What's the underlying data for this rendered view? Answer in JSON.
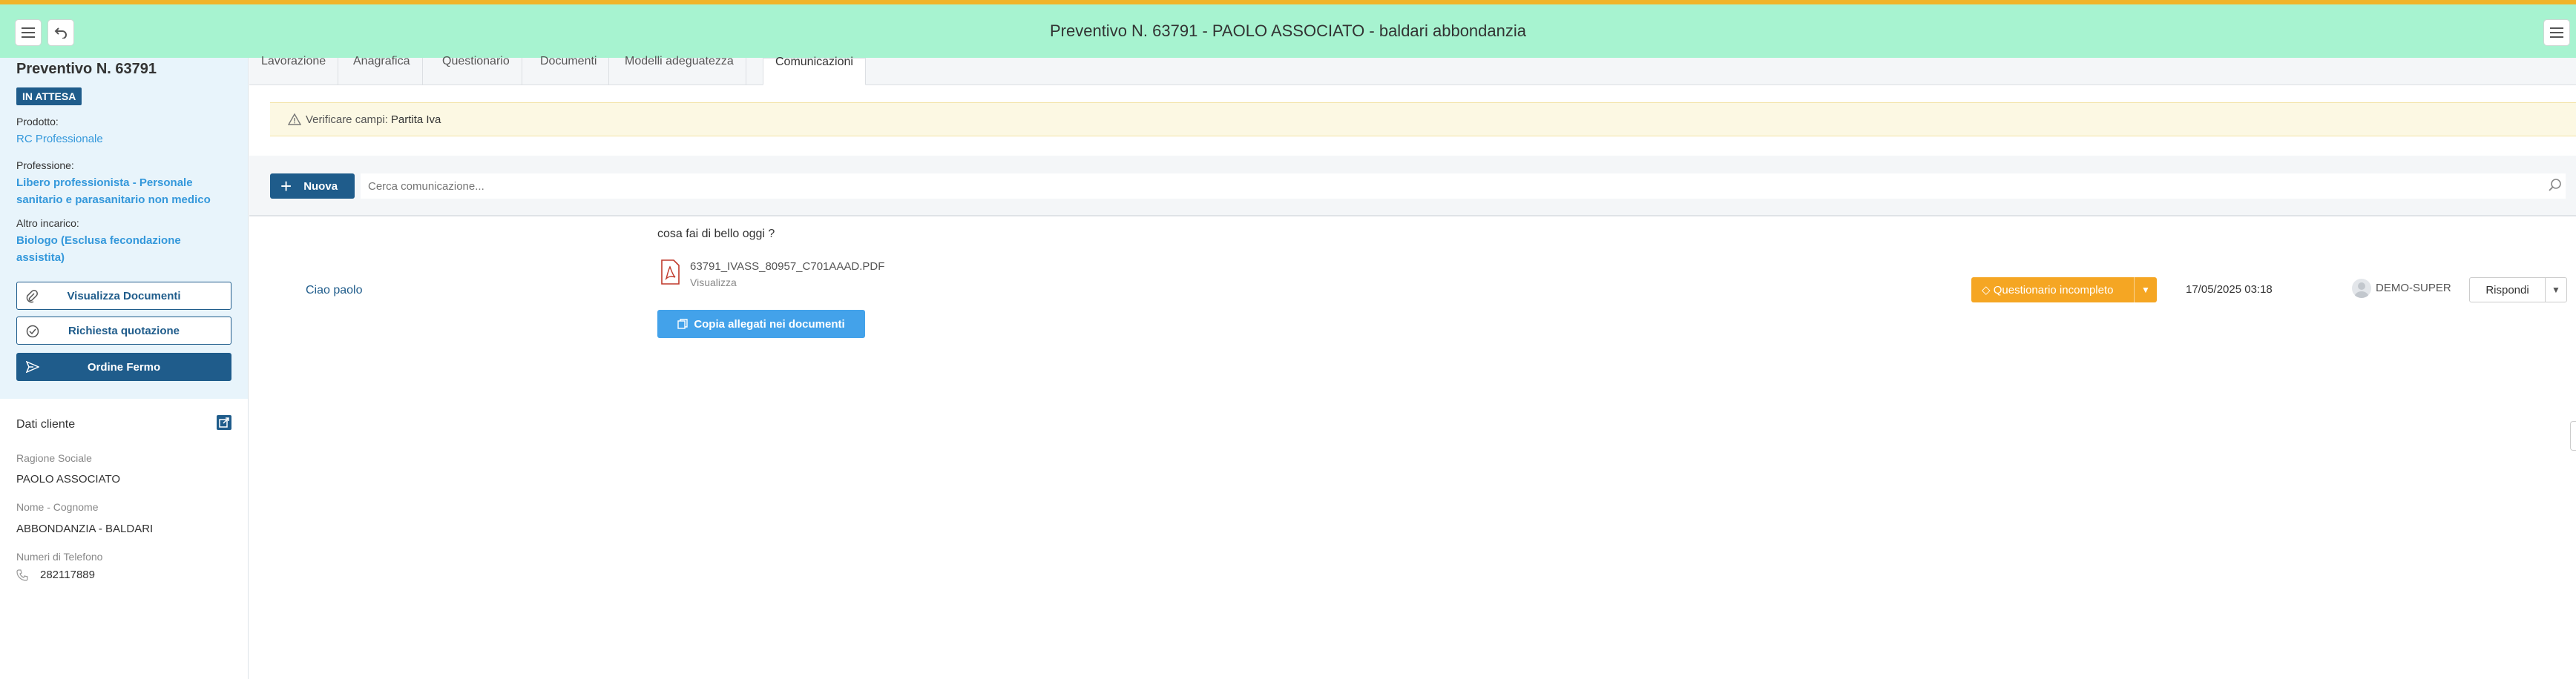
{
  "header": {
    "title": "Preventivo N. 63791 - PAOLO ASSOCIATO - baldari abbondanzia"
  },
  "sidebar": {
    "title": "Preventivo N. 63791",
    "status_badge": "IN ATTESA",
    "product_label": "Prodotto:",
    "product_value": "RC Professionale",
    "profession_label": "Professione:",
    "profession_value": "Libero professionista - Personale sanitario e parasanitario non medico",
    "other_label": "Altro incarico:",
    "other_value": "Biologo (Esclusa fecondazione assistita)",
    "buttons": {
      "view_docs": "Visualizza Documenti",
      "quote_request": "Richiesta quotazione",
      "firm_order": "Ordine Fermo"
    },
    "client": {
      "title": "Dati cliente",
      "company_label": "Ragione Sociale",
      "company_value": "PAOLO ASSOCIATO",
      "name_label": "Nome - Cognome",
      "name_value": "ABBONDANZIA - BALDARI",
      "phone_label": "Numeri di Telefono",
      "phone_value": "282117889"
    }
  },
  "tabs": [
    "Lavorazione",
    "Anagrafica",
    "Questionario",
    "Documenti",
    "Modelli adeguatezza",
    "Comunicazioni"
  ],
  "warning": {
    "text": "Verificare campi:",
    "field": "Partita Iva"
  },
  "toolbar": {
    "new_label": "Nuova",
    "search_placeholder": "Cerca comunicazione..."
  },
  "message": {
    "author": "Ciao paolo",
    "text": "cosa fai di bello oggi ?",
    "attachment_name": "63791_IVASS_80957_C701AAAD.PDF",
    "attachment_link": "Visualizza",
    "copy_button": "Copia allegati nei documenti",
    "status": "Questionario incompleto",
    "datetime": "17/05/2025 03:18",
    "user": "DEMO-SUPER",
    "reply_label": "Rispondi"
  },
  "colors": {
    "header_bg": "#a7f3d0",
    "primary": "#1f5c8b",
    "link": "#3498db",
    "warning_bg": "#fcf8e3",
    "status_orange": "#f5a623",
    "copy_blue": "#43a2ea"
  }
}
